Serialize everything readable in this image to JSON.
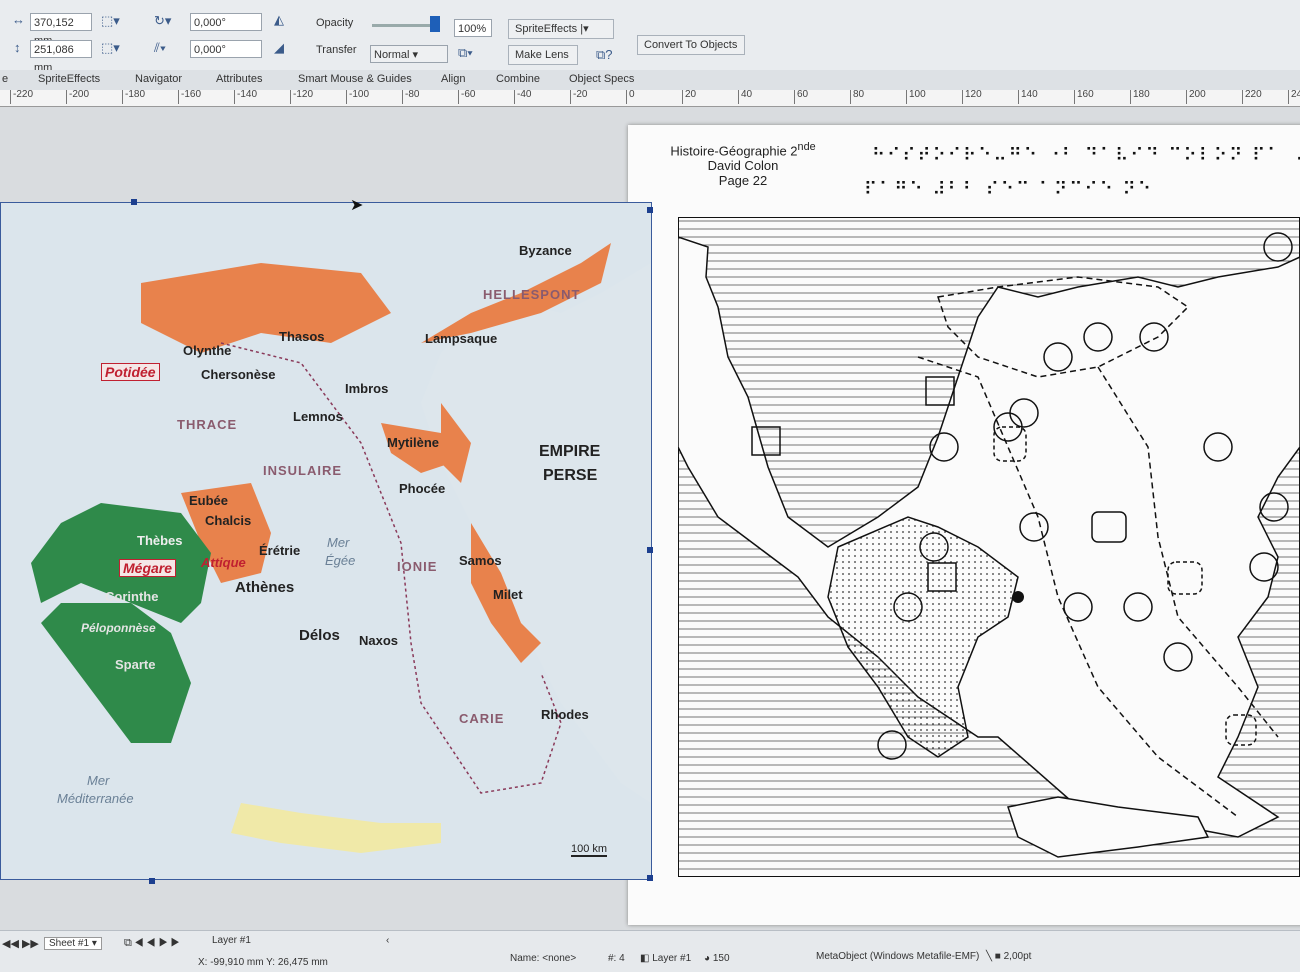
{
  "toolbar": {
    "x_value": "370,152 mm",
    "y_value": "251,086 mm",
    "rotate_value": "0,000°",
    "skew_value": "0,000°",
    "opacity_label": "Opacity",
    "opacity_value": "100%",
    "transfer_label": "Transfer",
    "transfer_mode": "Normal",
    "sprite_effects": "SpriteEffects",
    "make_lens": "Make Lens",
    "convert_button": "Convert To Objects"
  },
  "tabs": [
    "SpriteEffects",
    "Navigator",
    "Attributes",
    "Smart Mouse & Guides",
    "Align",
    "Combine",
    "Object Specs"
  ],
  "ruler_ticks": [
    "-220",
    "-200",
    "-180",
    "-160",
    "-140",
    "-120",
    "-100",
    "-80",
    "-60",
    "-40",
    "-20",
    "0",
    "20",
    "40",
    "60",
    "80",
    "100",
    "120",
    "140",
    "160",
    "180",
    "200",
    "220",
    "24"
  ],
  "color_map": {
    "labels": {
      "byzance": "Byzance",
      "hellespont": "HELLESPONT",
      "thasos": "Thasos",
      "lampsaque": "Lampsaque",
      "olynthe": "Olynthe",
      "chersonese": "Chersonèse",
      "imbros": "Imbros",
      "lemnos": "Lemnos",
      "thrace": "THRACE",
      "insulaire": "INSULAIRE",
      "mytilene": "Mytilène",
      "phocee": "Phocée",
      "empire": "EMPIRE",
      "perse": "PERSE",
      "eubee": "Eubée",
      "chalcis": "Chalcis",
      "thebes": "Thèbes",
      "eretrie": "Érétrie",
      "attique": "Attique",
      "athenes": "Athènes",
      "corinthe": "Corinthe",
      "peloponnese": "Péloponnèse",
      "sparte": "Sparte",
      "mer": "Mer",
      "egee": "Égée",
      "ionie": "IONIE",
      "samos": "Samos",
      "milet": "Milet",
      "delos": "Délos",
      "naxos": "Naxos",
      "carie": "CARIE",
      "rhodes": "Rhodes",
      "mer2": "Mer",
      "mediterranee": "Méditerranée",
      "scale": "100 km"
    },
    "boxed": {
      "potidee": "Potidée",
      "megare": "Mégare"
    }
  },
  "tactile_page": {
    "subject": "Histoire-Géographie 2",
    "superscript": "nde",
    "author": "David Colon",
    "page": "Page 22",
    "braille_line1": "⠓⠊⠎⠞⠕⠊⠗⠑⠤⠛⠑ ⠐⠃ ⠙⠁⠧⠊⠙ ⠉⠕⠇⠕⠝ ⠏⠁ ⠠",
    "braille_line2": "⠏⠁⠛⠑ ⠼⠃⠃ ⠎⠑⠉ ⠁⠝⠉⠊⠑ ⠝⠑"
  },
  "status": {
    "sheet": "Sheet #1",
    "layer": "Layer #1",
    "coords": "X: -99,910 mm Y: 26,475 mm",
    "name": "Name: <none>",
    "count": "#: 4",
    "layer2": "Layer #1",
    "zoom": "150",
    "object_type": "MetaObject (Windows Metafile-EMF)",
    "line_width": "2,00pt"
  }
}
